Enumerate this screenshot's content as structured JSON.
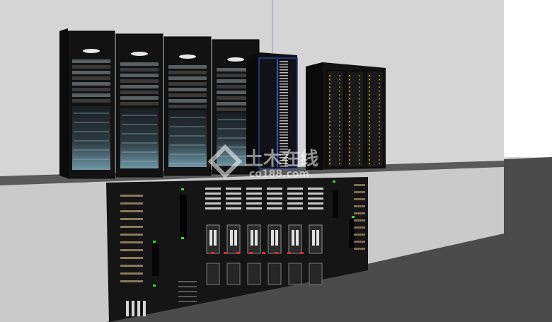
{
  "scene": {
    "description_free": true,
    "colors": {
      "wall_upper": "#d3d3d3",
      "wall_lower": "#c9c9c9",
      "floor": "#4a4a4a",
      "right_plane": "#ffffff",
      "cabinet": "#111111",
      "rack_glow": "#7ea8b8",
      "blue_trim": "#3355cc",
      "amber_led": "#c88a2a",
      "green_led": "#3fd24a",
      "red_led": "#d83030"
    }
  },
  "watermark": {
    "cn_text": "土木在线",
    "url_text": "co188.com"
  },
  "objects": {
    "rack_group_left": "server-rack",
    "rack_blue": "network-rack",
    "rack_amber": "storage-rack",
    "console": "control-console"
  }
}
